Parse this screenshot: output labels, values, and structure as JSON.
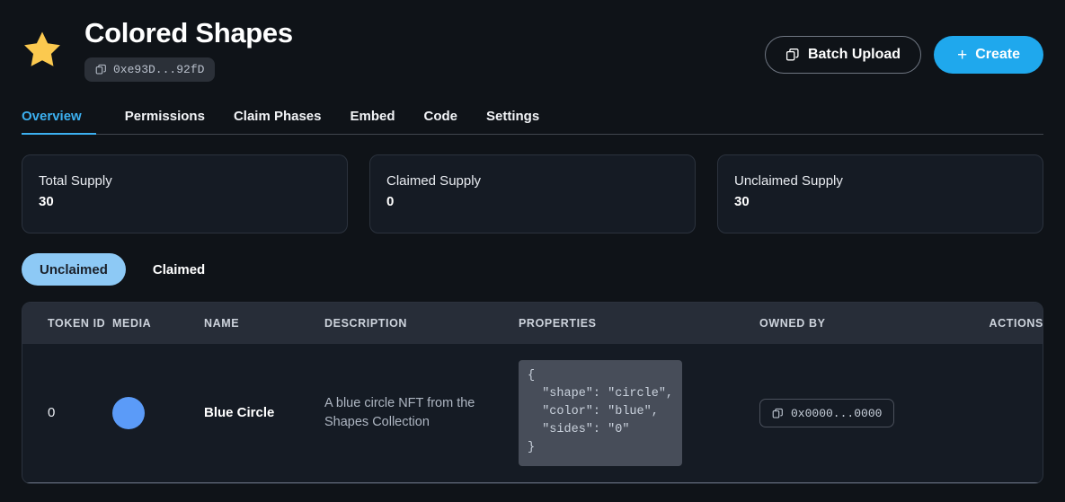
{
  "header": {
    "icon": "star-icon",
    "title": "Colored Shapes",
    "contract_address": "0xe93D...92fD",
    "copy_icon": "copy-icon",
    "batch_upload_label": "Batch Upload",
    "batch_upload_icon": "copy-stack-icon",
    "create_label": "Create",
    "create_plus": "+",
    "accent_color": "#1fa8ed",
    "star_color": "#fbc94f"
  },
  "tabs": [
    {
      "label": "Overview",
      "active": true
    },
    {
      "label": "Permissions",
      "active": false
    },
    {
      "label": "Claim Phases",
      "active": false
    },
    {
      "label": "Embed",
      "active": false
    },
    {
      "label": "Code",
      "active": false
    },
    {
      "label": "Settings",
      "active": false
    }
  ],
  "stats": [
    {
      "label": "Total Supply",
      "value": "30"
    },
    {
      "label": "Claimed Supply",
      "value": "0"
    },
    {
      "label": "Unclaimed Supply",
      "value": "30"
    }
  ],
  "filters": [
    {
      "label": "Unclaimed",
      "active": true
    },
    {
      "label": "Claimed",
      "active": false
    }
  ],
  "table": {
    "columns": [
      "TOKEN ID",
      "MEDIA",
      "NAME",
      "DESCRIPTION",
      "PROPERTIES",
      "OWNED BY",
      "ACTIONS"
    ],
    "rows": [
      {
        "token_id": "0",
        "media_icon": "blue-circle-thumbnail",
        "media_color": "#5b9bf8",
        "name": "Blue Circle",
        "description": "A blue circle NFT from the Shapes Collection",
        "properties": "{\n  \"shape\": \"circle\",\n  \"color\": \"blue\",\n  \"sides\": \"0\"\n}",
        "owned_by": "0x0000...0000",
        "owned_by_icon": "copy-icon",
        "actions": ""
      }
    ]
  }
}
